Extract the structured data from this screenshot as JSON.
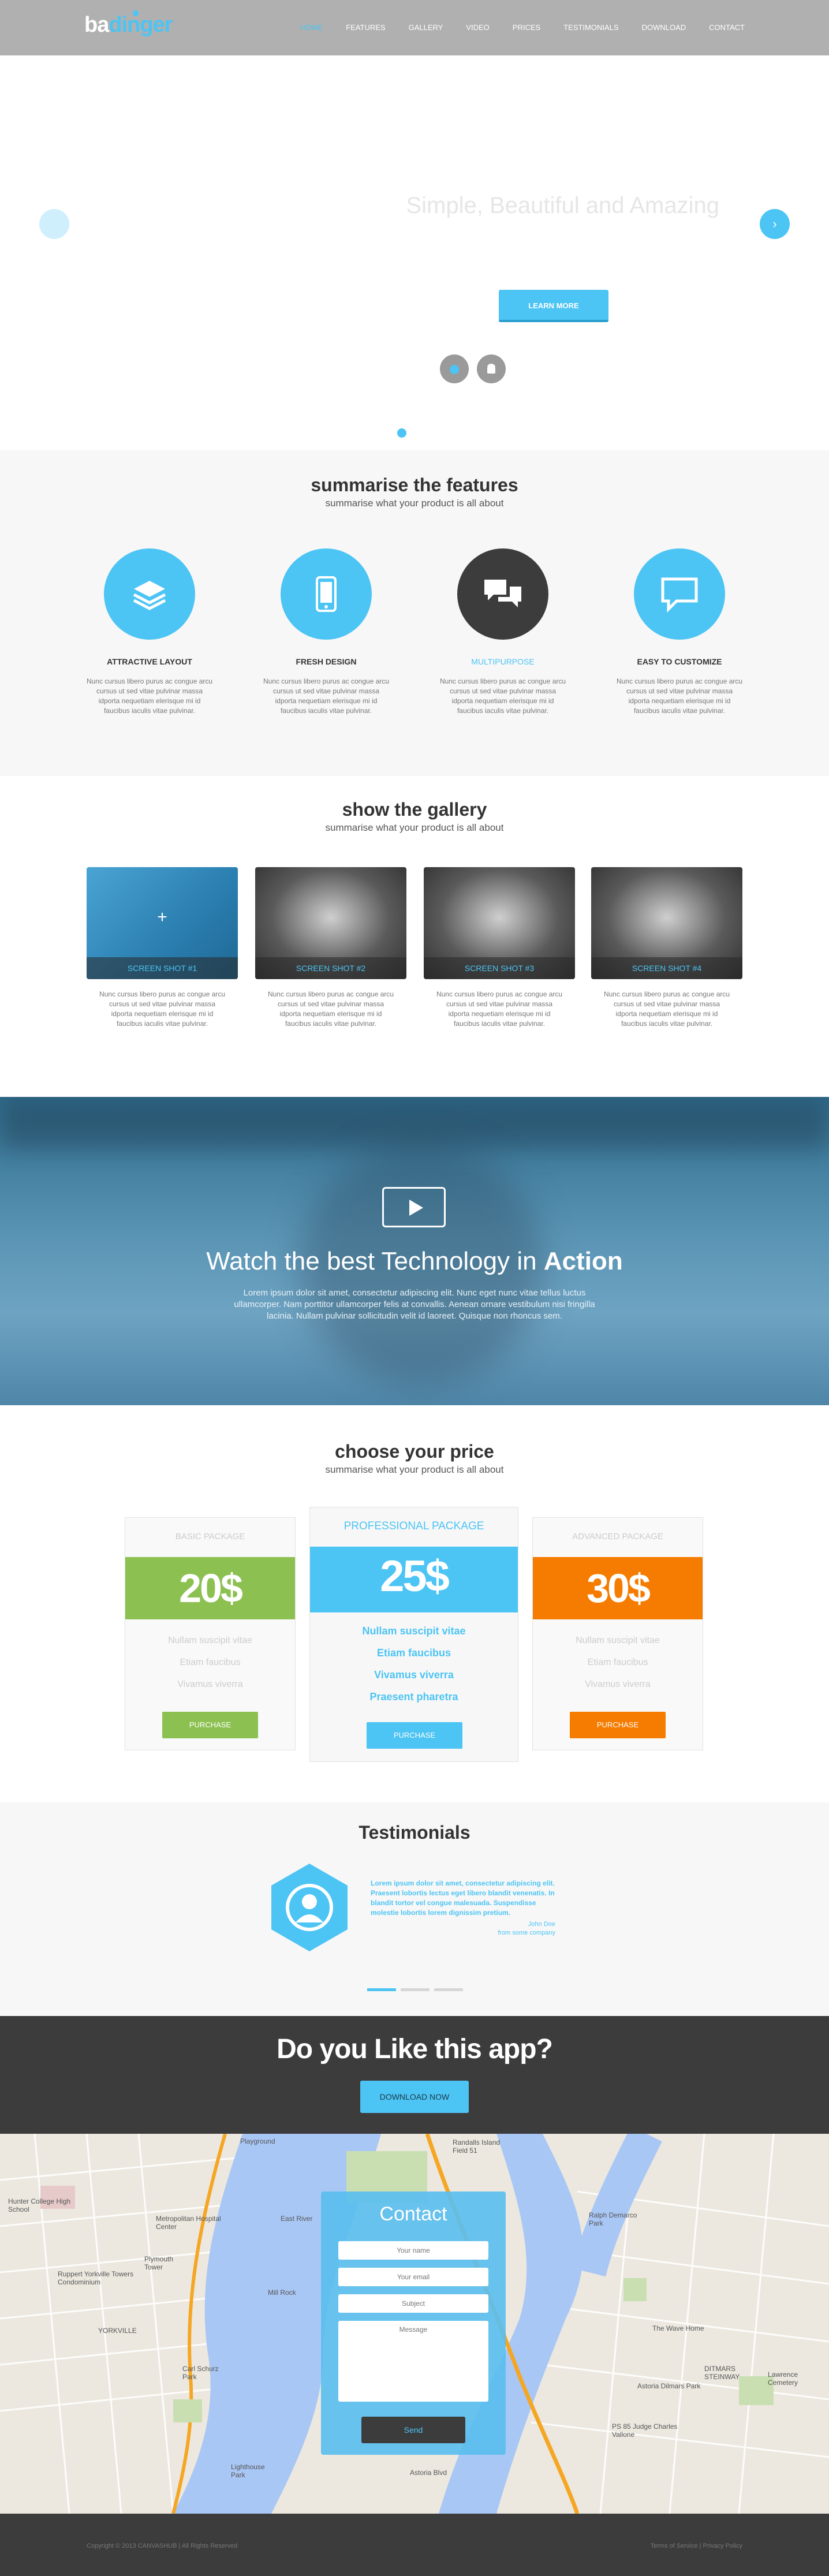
{
  "header": {
    "logo_part1": "ba",
    "logo_part2": "dinger",
    "nav": [
      "HOME",
      "FEATURES",
      "GALLERY",
      "VIDEO",
      "PRICES",
      "TESTIMONIALS",
      "DOWNLOAD",
      "CONTACT"
    ],
    "active_index": 0
  },
  "hero": {
    "title": "Simple, Beautiful and Amazing",
    "cta_label": "LEARN MORE",
    "stores": [
      "apple-icon",
      "android-icon"
    ]
  },
  "features": {
    "title": "summarise the features",
    "subtitle": "summarise what your product is all about",
    "items": [
      {
        "title": "ATTRACTIVE LAYOUT",
        "icon": "layers-icon",
        "text": "Nunc cursus libero purus ac congue arcu cursus ut sed vitae pulvinar massa idporta nequetiam elerisque mi id faucibus iaculis vitae pulvinar."
      },
      {
        "title": "FRESH DESIGN",
        "icon": "phone-icon",
        "text": "Nunc cursus libero purus ac congue arcu cursus ut sed vitae pulvinar massa idporta nequetiam elerisque mi id faucibus iaculis vitae pulvinar."
      },
      {
        "title": "MULTIPURPOSE",
        "icon": "chat-icon",
        "text": "Nunc cursus libero purus ac congue arcu cursus ut sed vitae pulvinar massa idporta nequetiam elerisque mi id faucibus iaculis vitae pulvinar."
      },
      {
        "title": "EASY TO CUSTOMIZE",
        "icon": "message-icon",
        "text": "Nunc cursus libero purus ac congue arcu cursus ut sed vitae pulvinar massa idporta nequetiam elerisque mi id faucibus iaculis vitae pulvinar."
      }
    ]
  },
  "gallery": {
    "title": "show the gallery",
    "subtitle": "summarise what your product is all about",
    "items": [
      {
        "label": "SCREEN SHOT #1",
        "text": "Nunc cursus libero purus ac congue arcu cursus ut sed vitae pulvinar massa idporta nequetiam elerisque mi id faucibus iaculis vitae pulvinar."
      },
      {
        "label": "SCREEN SHOT #2",
        "text": "Nunc cursus libero purus ac congue arcu cursus ut sed vitae pulvinar massa idporta nequetiam elerisque mi id faucibus iaculis vitae pulvinar."
      },
      {
        "label": "SCREEN SHOT #3",
        "text": "Nunc cursus libero purus ac congue arcu cursus ut sed vitae pulvinar massa idporta nequetiam elerisque mi id faucibus iaculis vitae pulvinar."
      },
      {
        "label": "SCREEN SHOT #4",
        "text": "Nunc cursus libero purus ac congue arcu cursus ut sed vitae pulvinar massa idporta nequetiam elerisque mi id faucibus iaculis vitae pulvinar."
      }
    ]
  },
  "video": {
    "title_prefix": "Watch the best Technology in ",
    "title_bold": "Action",
    "text": "Lorem ipsum dolor sit amet, consectetur adipiscing elit. Nunc eget nunc vitae tellus luctus ullamcorper. Nam porttitor ullamcorper felis at convallis. Aenean ornare vestibulum nisi fringilla lacinia. Nullam pulvinar sollicitudin velit id laoreet. Quisque non rhoncus sem."
  },
  "pricing": {
    "title": "choose your price",
    "subtitle": "summarise what your product is all about",
    "plans": [
      {
        "name": "BASIC PACKAGE",
        "price": "20$",
        "color": "#8cc152",
        "features": [
          "Nullam suscipit vitae",
          "Etiam faucibus",
          "Vivamus viverra"
        ],
        "button": "PURCHASE"
      },
      {
        "name": "PROFESSIONAL PACKAGE",
        "price": "25$",
        "color": "#4cc4f4",
        "features": [
          "Nullam suscipit vitae",
          "Etiam faucibus",
          "Vivamus viverra",
          "Praesent pharetra"
        ],
        "button": "PURCHASE"
      },
      {
        "name": "ADVANCED PACKAGE",
        "price": "30$",
        "color": "#f57c00",
        "features": [
          "Nullam suscipit vitae",
          "Etiam faucibus",
          "Vivamus viverra"
        ],
        "button": "PURCHASE"
      }
    ]
  },
  "testimonials": {
    "title": "Testimonials",
    "quote": "Lorem ipsum dolor sit amet, consectetur adipiscing elit. Praesent lobortis lectus eget libero blandit venenatis. In blandit tortor vel congue malesuada. Suspendisse molestie lobortis lorem dignissim pretium.",
    "author_name": "John Doe",
    "author_company": "from some company"
  },
  "cta": {
    "title": "Do you Like this app?",
    "button": "DOWNLOAD NOW"
  },
  "contact": {
    "title": "Contact",
    "name_placeholder": "Your name",
    "email_placeholder": "Your email",
    "subject_placeholder": "Subject",
    "message_placeholder": "Message",
    "send_label": "Send"
  },
  "map": {
    "labels": [
      "Playground",
      "Randalls Island Field 51",
      "Hunter College High School",
      "Metropolitan Hospital Center",
      "Plymouth Tower",
      "Ruppert Yorkville Towers Condominium",
      "Mill Rock",
      "East River",
      "Ralph Demarco Park",
      "The Wave Home",
      "Astoria Dilmars Park",
      "Lawrence Cemetery",
      "PS 85 Judge Charles Vallone",
      "Carl Schurz Park",
      "Lighthouse Park",
      "Astoria Blvd",
      "YORKVILLE",
      "DITMARS STEINWAY"
    ]
  },
  "footer": {
    "copyright": "Copyright © 2013 CANVASHUB | All Rights Reserved",
    "links": "Terms of Service | Privacy Policy"
  },
  "colors": {
    "accent": "#4cc4f4",
    "dark": "#3c3c3c",
    "green": "#8cc152",
    "orange": "#f57c00",
    "header_bg": "#b0b0b0"
  }
}
